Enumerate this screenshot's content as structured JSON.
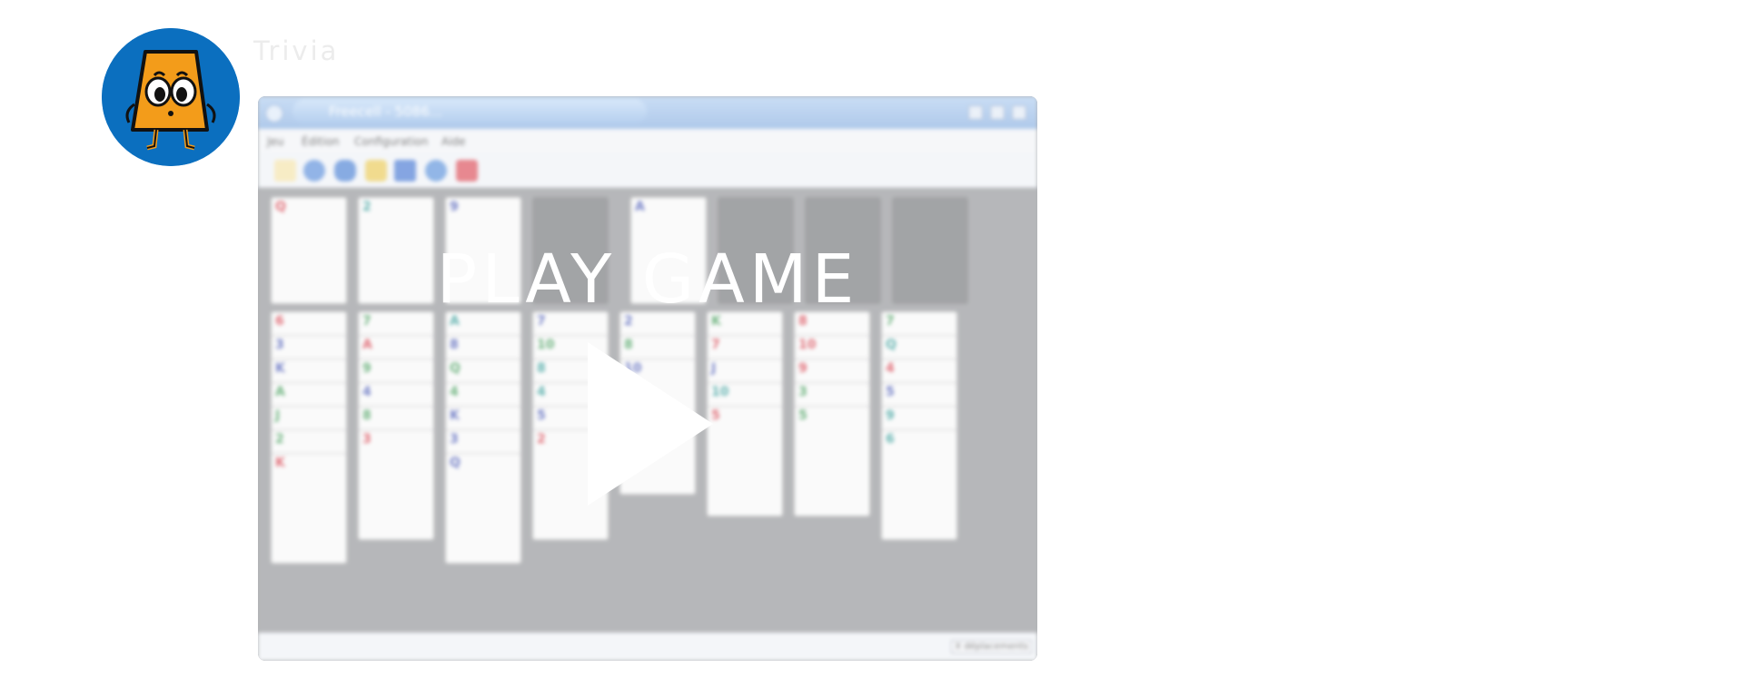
{
  "channel": {
    "name": "Trivia",
    "avatar_icon": "orange-trapezoid-mascot-icon"
  },
  "video": {
    "window_title": "Freecell - 5086...",
    "menu": [
      "Jeu",
      "Édition",
      "Configuration",
      "Aide"
    ],
    "toolbar_icons": [
      "new-game-icon",
      "restart-icon",
      "undo-icon",
      "hint-icon",
      "demo-icon",
      "help-icon",
      "quit-icon"
    ],
    "status_moves": "X déplacements",
    "overlay_label": "PLAY GAME",
    "play_icon": "play-icon",
    "top_cards": [
      "Q",
      "2",
      "9",
      "",
      "A",
      "",
      "",
      ""
    ],
    "columns": [
      [
        "6",
        "3",
        "K",
        "A",
        "J",
        "2",
        "K"
      ],
      [
        "7",
        "A",
        "9",
        "4",
        "8",
        "3"
      ],
      [
        "A",
        "8",
        "Q",
        "4",
        "K",
        "3",
        "Q"
      ],
      [
        "7",
        "10",
        "8",
        "4",
        "5",
        "2"
      ],
      [
        "2",
        "8",
        "10"
      ],
      [
        "K",
        "7",
        "J",
        "10",
        "5"
      ],
      [
        "8",
        "10",
        "9",
        "3",
        "5"
      ],
      [
        "7",
        "Q",
        "4",
        "5",
        "9",
        "6"
      ]
    ]
  },
  "colors": {
    "avatar_bg": "#0b6fbf",
    "mascot": "#f39c1a",
    "window_titlebar": "#8fb3e6",
    "felt": "#8a8c90"
  }
}
